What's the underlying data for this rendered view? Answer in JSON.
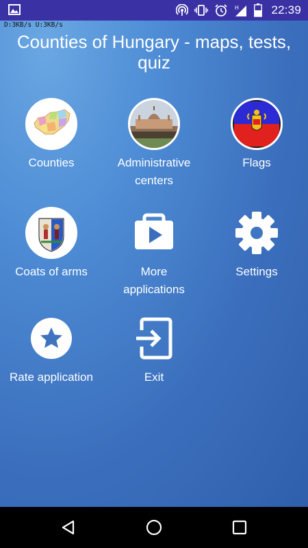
{
  "status_bar": {
    "time": "22:39",
    "icons": [
      "image-icon",
      "hotspot-icon",
      "vibrate-icon",
      "alarm-icon",
      "signal-h-icon",
      "battery-icon"
    ],
    "network_type": "H"
  },
  "speed_indicator": "D:3KB/s  U:3KB/s",
  "header": {
    "title": "Counties of Hungary - maps, tests, quiz"
  },
  "menu": [
    {
      "id": "counties",
      "label": "Counties",
      "icon": "hungary-map-icon"
    },
    {
      "id": "administrative-centers",
      "label": "Administrative centers",
      "icon": "parliament-photo-icon"
    },
    {
      "id": "flags",
      "label": "Flags",
      "icon": "county-flag-icon"
    },
    {
      "id": "coats-of-arms",
      "label": "Coats of arms",
      "icon": "coat-of-arms-icon"
    },
    {
      "id": "more-applications",
      "label": "More applications",
      "icon": "play-store-bag-icon"
    },
    {
      "id": "settings",
      "label": "Settings",
      "icon": "gear-icon"
    },
    {
      "id": "rate-application",
      "label": "Rate application",
      "icon": "star-icon"
    },
    {
      "id": "exit",
      "label": "Exit",
      "icon": "exit-icon"
    }
  ],
  "colors": {
    "status_bar": "#3a31a4",
    "background_top": "#6aa7e3",
    "background_bottom": "#2f5fab",
    "text": "#ffffff",
    "nav_bar": "#000000"
  },
  "nav_bar": {
    "buttons": [
      "back-icon",
      "home-icon",
      "recents-icon"
    ]
  }
}
